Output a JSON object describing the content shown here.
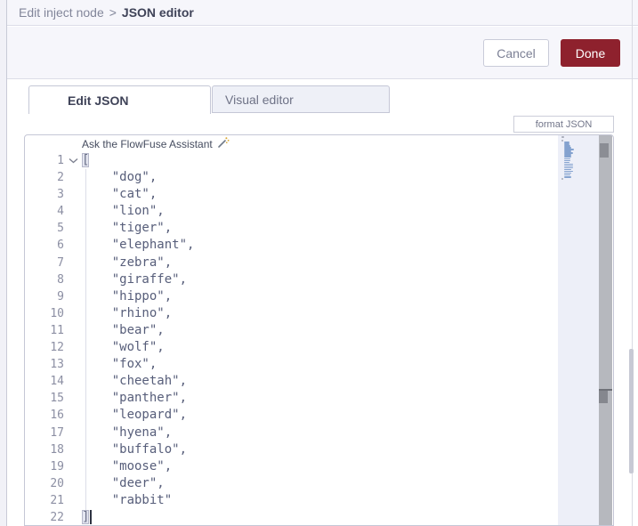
{
  "breadcrumb": {
    "parent_label": "Edit inject node",
    "separator": ">",
    "current_label": "JSON editor"
  },
  "actions": {
    "cancel_label": "Cancel",
    "done_label": "Done"
  },
  "tabs": {
    "edit_json_label": "Edit JSON",
    "visual_editor_label": "Visual editor",
    "active_tab": "Edit JSON"
  },
  "toolbar": {
    "format_json_label": "format JSON"
  },
  "editor": {
    "assistant_hint": "Ask the FlowFuse Assistant",
    "assistant_icon": "magic-wand-sparkles-icon",
    "language": "json",
    "cursor_position": {
      "line": 22,
      "after_char": "]"
    },
    "lines": [
      {
        "num": 1,
        "text": "[",
        "fold": true,
        "bracket_match": true
      },
      {
        "num": 2,
        "text": "    \"dog\","
      },
      {
        "num": 3,
        "text": "    \"cat\","
      },
      {
        "num": 4,
        "text": "    \"lion\","
      },
      {
        "num": 5,
        "text": "    \"tiger\","
      },
      {
        "num": 6,
        "text": "    \"elephant\","
      },
      {
        "num": 7,
        "text": "    \"zebra\","
      },
      {
        "num": 8,
        "text": "    \"giraffe\","
      },
      {
        "num": 9,
        "text": "    \"hippo\","
      },
      {
        "num": 10,
        "text": "    \"rhino\","
      },
      {
        "num": 11,
        "text": "    \"bear\","
      },
      {
        "num": 12,
        "text": "    \"wolf\","
      },
      {
        "num": 13,
        "text": "    \"fox\","
      },
      {
        "num": 14,
        "text": "    \"cheetah\","
      },
      {
        "num": 15,
        "text": "    \"panther\","
      },
      {
        "num": 16,
        "text": "    \"leopard\","
      },
      {
        "num": 17,
        "text": "    \"hyena\","
      },
      {
        "num": 18,
        "text": "    \"buffalo\","
      },
      {
        "num": 19,
        "text": "    \"moose\","
      },
      {
        "num": 20,
        "text": "    \"deer\","
      },
      {
        "num": 21,
        "text": "    \"rabbit\""
      },
      {
        "num": 22,
        "text": "]",
        "bracket_match": true,
        "cursor": true
      }
    ]
  },
  "colors": {
    "done_button_bg": "#8e212d",
    "band_bg": "#f6f6fb",
    "accent_text": "#3f4358",
    "code_text": "#575e7a",
    "minimap_mark": "#84a2cf",
    "scroll_track": "#b6b8be"
  }
}
